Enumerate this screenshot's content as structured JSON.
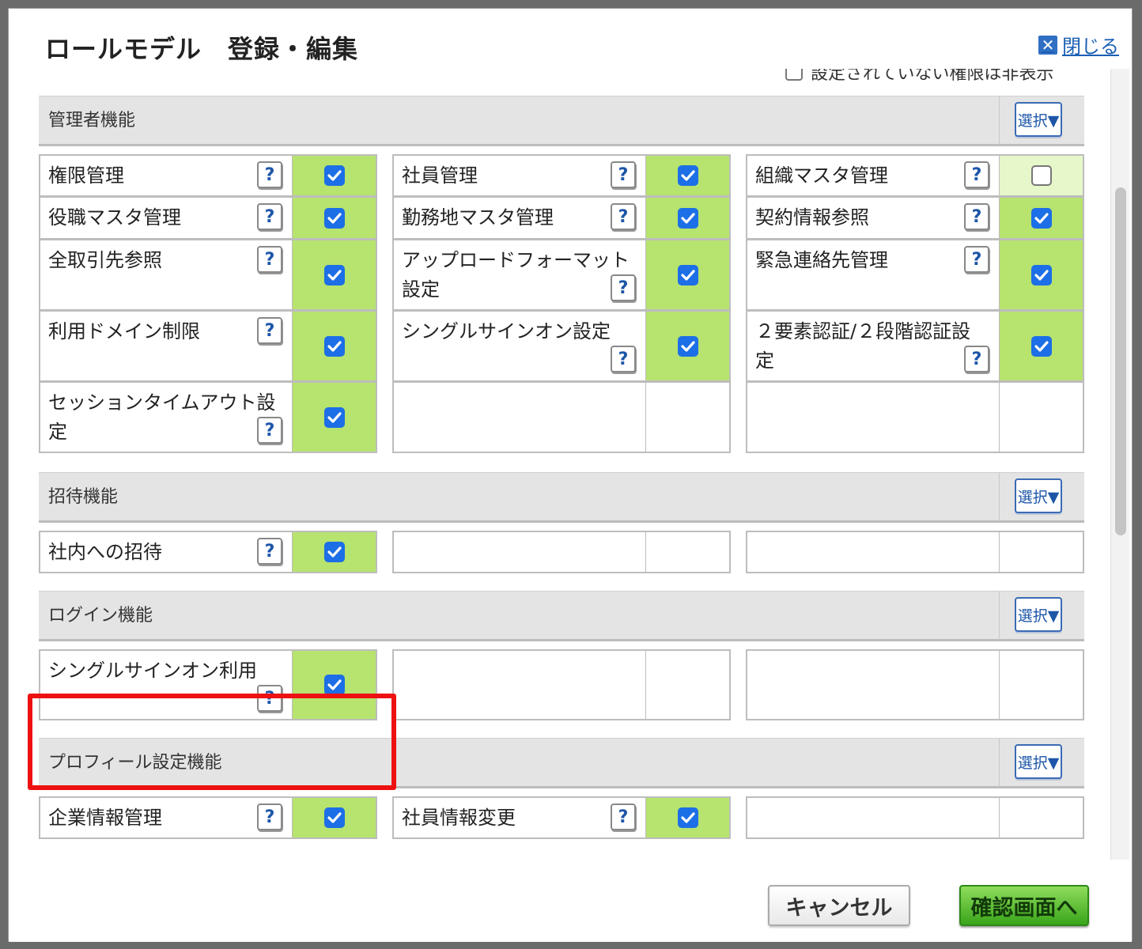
{
  "dialog": {
    "title": "ロールモデル　登録・編集",
    "close_label": "閉じる",
    "close_icon": "close-icon"
  },
  "partial_option_text": "設定されていない権限は非表示",
  "select_button_label": "選択▼",
  "help_label": "?",
  "sections": [
    {
      "title": "管理者機能",
      "columns": [
        [
          {
            "label": "権限管理",
            "checked": true
          },
          {
            "label": "役職マスタ管理",
            "checked": true
          },
          {
            "label": "全取引先参照",
            "checked": true
          },
          {
            "label": "利用ドメイン制限",
            "checked": true
          },
          {
            "label": "セッションタイムアウト設定",
            "checked": true
          }
        ],
        [
          {
            "label": "社員管理",
            "checked": true
          },
          {
            "label": "勤務地マスタ管理",
            "checked": true
          },
          {
            "label": "アップロードフォーマット設定",
            "checked": true
          },
          {
            "label": "シングルサインオン設定",
            "checked": true
          },
          null
        ],
        [
          {
            "label": "組織マスタ管理",
            "checked": false
          },
          {
            "label": "契約情報参照",
            "checked": true
          },
          {
            "label": "緊急連絡先管理",
            "checked": true
          },
          {
            "label": "２要素認証/２段階認証設定",
            "checked": true
          },
          null
        ]
      ]
    },
    {
      "title": "招待機能",
      "columns": [
        [
          {
            "label": "社内への招待",
            "checked": true
          }
        ],
        [
          null
        ],
        [
          null
        ]
      ]
    },
    {
      "title": "ログイン機能",
      "columns": [
        [
          {
            "label": "シングルサインオン利用",
            "checked": true
          }
        ],
        [
          null
        ],
        [
          null
        ]
      ]
    },
    {
      "title": "プロフィール設定機能",
      "columns": [
        [
          {
            "label": "企業情報管理",
            "checked": true
          }
        ],
        [
          {
            "label": "社員情報変更",
            "checked": true
          }
        ],
        [
          null
        ]
      ]
    }
  ],
  "footer": {
    "cancel_label": "キャンセル",
    "confirm_label": "確認画面へ"
  },
  "colors": {
    "checked_bg": "#b7e36f",
    "unchecked_bg": "#e6f7c9",
    "checkbox_blue": "#1c6fe6",
    "highlight": "#ee1111",
    "confirm_green": "#3aa51b"
  }
}
